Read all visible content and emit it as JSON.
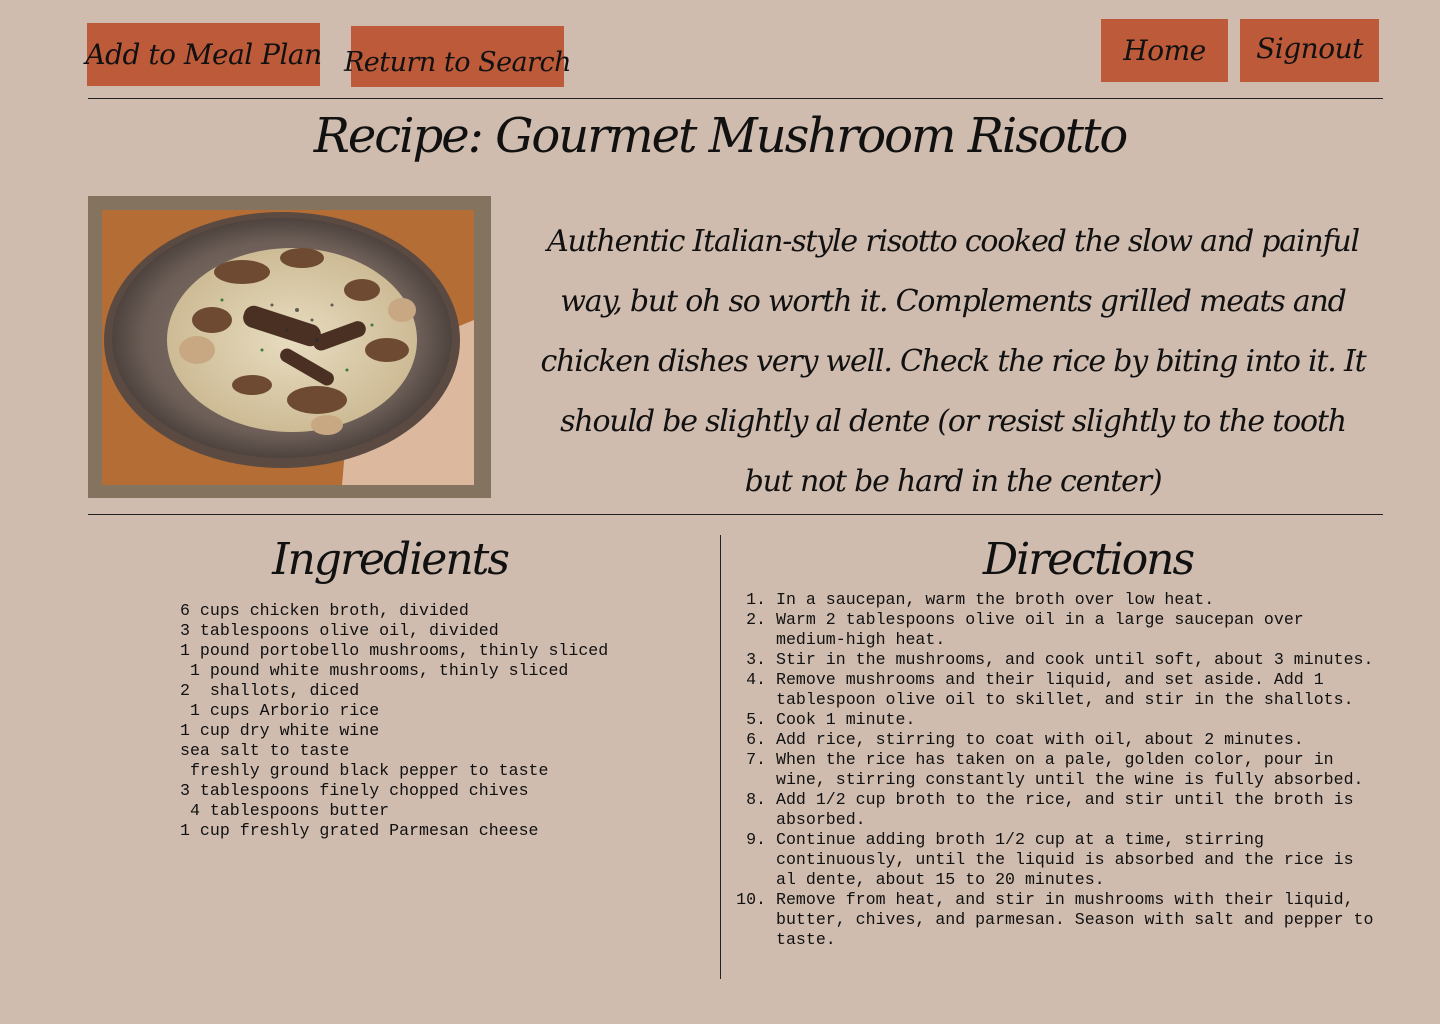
{
  "nav": {
    "add_to_meal_plan": "Add to Meal Plan",
    "return_to_search": "Return to Search",
    "home": "Home",
    "signout": "Signout"
  },
  "recipe": {
    "title": "Recipe: Gourmet Mushroom Risotto",
    "description": "Authentic Italian-style risotto cooked the slow and painful way, but oh so worth it. Complements grilled meats and chicken dishes very well.  Check the rice by biting into it. It should be slightly al dente (or resist slightly to the tooth but not be hard in the center)",
    "image_alt": "Mushroom risotto in a bowl"
  },
  "ingredients": {
    "title": "Ingredients",
    "items": [
      "6 cups chicken broth, divided",
      "3 tablespoons olive oil, divided",
      "1 pound portobello mushrooms, thinly sliced",
      " 1 pound white mushrooms, thinly sliced",
      "2  shallots, diced",
      " 1 cups Arborio rice",
      "1 cup dry white wine",
      "sea salt to taste",
      " freshly ground black pepper to taste",
      "3 tablespoons finely chopped chives",
      " 4 tablespoons butter",
      "1 cup freshly grated Parmesan cheese"
    ]
  },
  "directions": {
    "title": "Directions",
    "steps": [
      {
        "num": "1.",
        "text": "In a saucepan, warm the broth over low heat."
      },
      {
        "num": "2.",
        "text": "Warm 2 tablespoons olive oil in a large saucepan over medium-high heat."
      },
      {
        "num": "3.",
        "text": "Stir in the mushrooms, and cook until soft, about 3 minutes."
      },
      {
        "num": "4.",
        "text": "Remove mushrooms and their liquid, and set aside. Add 1 tablespoon olive oil to skillet,  and stir in the shallots."
      },
      {
        "num": "5.",
        "text": "Cook 1 minute."
      },
      {
        "num": "6.",
        "text": "Add rice, stirring to coat with oil, about 2 minutes."
      },
      {
        "num": "7.",
        "text": "When the rice has taken on a pale, golden color, pour in wine, stirring constantly until the wine is fully absorbed."
      },
      {
        "num": "8.",
        "text": "Add 1/2 cup broth to the rice, and stir until the broth is absorbed."
      },
      {
        "num": "9.",
        "text": "Continue adding broth 1/2 cup at a time, stirring continuously, until the liquid is absorbed and the rice is al dente, about 15 to 20 minutes."
      },
      {
        "num": "10.",
        "text": "Remove from heat, and stir in mushrooms with their liquid, butter, chives, and parmesan. Season with salt and pepper to taste."
      }
    ]
  },
  "colors": {
    "background": "#d0bcaf",
    "button": "#bd5a3a",
    "photo_frame": "#84735f"
  }
}
